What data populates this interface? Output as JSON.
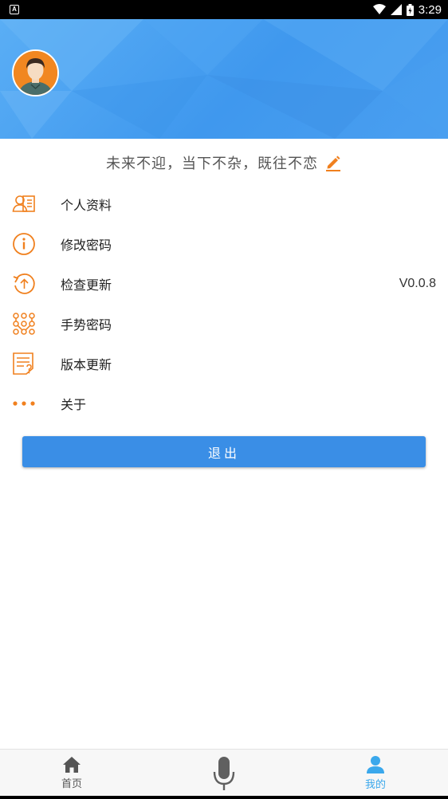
{
  "status_bar": {
    "app_icon_letter": "A",
    "time": "3:29"
  },
  "profile": {
    "motto": "未来不迎，当下不杂，既往不恋"
  },
  "menu": {
    "items": [
      {
        "label": "个人资料",
        "icon": "profile-card-icon"
      },
      {
        "label": "修改密码",
        "icon": "info-circle-icon"
      },
      {
        "label": "检查更新",
        "icon": "update-arrow-icon",
        "value": "V0.0.8"
      },
      {
        "label": "手势密码",
        "icon": "gesture-pattern-icon"
      },
      {
        "label": "版本更新",
        "icon": "document-question-icon"
      },
      {
        "label": "关于",
        "icon": "more-dots-icon"
      }
    ]
  },
  "logout": {
    "label": "退出"
  },
  "bottom_nav": {
    "home_label": "首页",
    "mine_label": "我的"
  },
  "colors": {
    "header_blue": "#3f98ee",
    "icon_orange": "#f0801e",
    "button_blue": "#3a8ee6",
    "nav_active": "#3aa8ec"
  }
}
